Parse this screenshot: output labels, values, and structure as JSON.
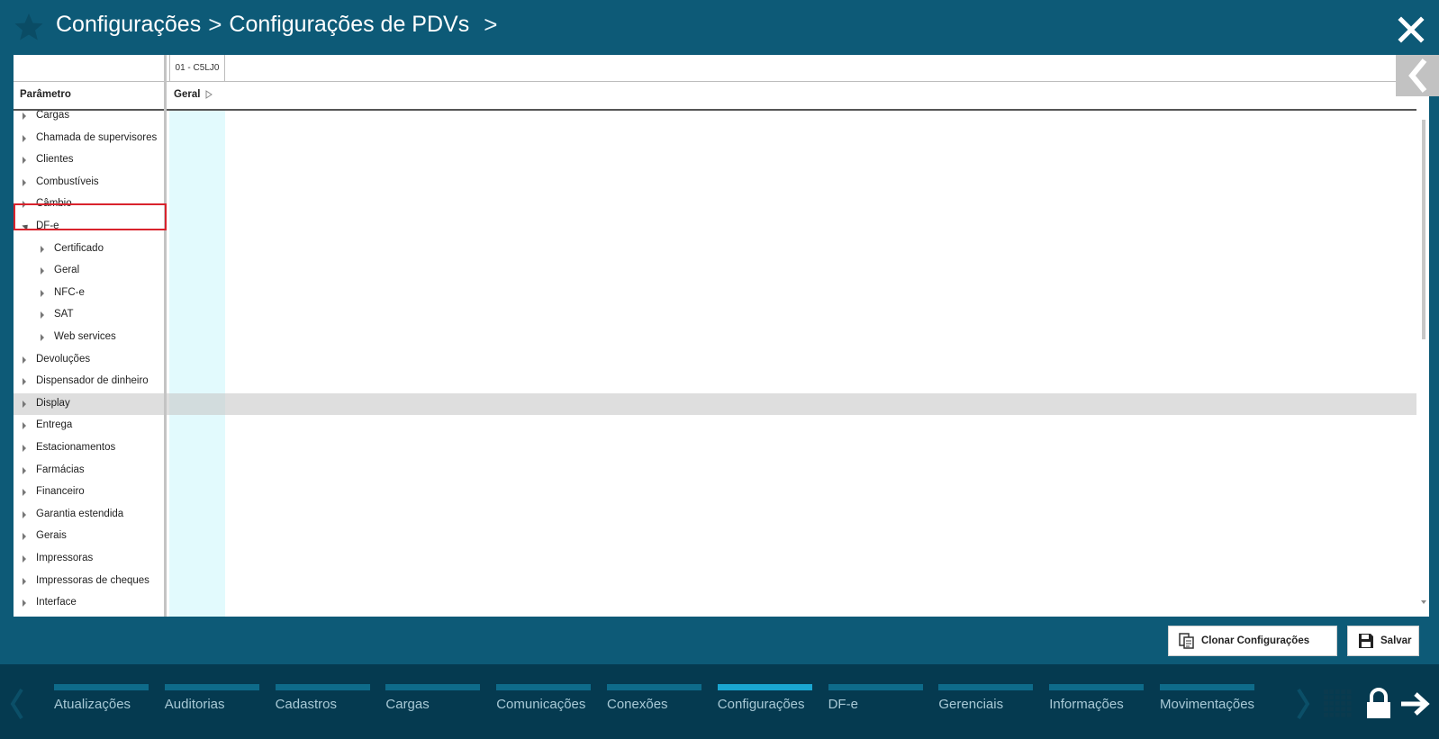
{
  "header": {
    "breadcrumb_1": "Configurações",
    "separator": ">",
    "breadcrumb_2": "Configurações de PDVs",
    "separator_2": ">"
  },
  "grid": {
    "pdv_column": "01 - C5LJ0",
    "param_header": "Parâmetro",
    "group_header": "Geral",
    "rows": [
      {
        "label": "Cargas",
        "level": 0,
        "expanded": false
      },
      {
        "label": "Chamada de supervisores",
        "level": 0,
        "expanded": false
      },
      {
        "label": "Clientes",
        "level": 0,
        "expanded": false
      },
      {
        "label": "Combustíveis",
        "level": 0,
        "expanded": false
      },
      {
        "label": "Câmbio",
        "level": 0,
        "expanded": false
      },
      {
        "label": "DF-e",
        "level": 0,
        "expanded": true
      },
      {
        "label": "Certificado",
        "level": 1,
        "expanded": false
      },
      {
        "label": "Geral",
        "level": 1,
        "expanded": false
      },
      {
        "label": "NFC-e",
        "level": 1,
        "expanded": false
      },
      {
        "label": "SAT",
        "level": 1,
        "expanded": false
      },
      {
        "label": "Web services",
        "level": 1,
        "expanded": false
      },
      {
        "label": "Devoluções",
        "level": 0,
        "expanded": false
      },
      {
        "label": "Dispensador de dinheiro",
        "level": 0,
        "expanded": false
      },
      {
        "label": "Display",
        "level": 0,
        "expanded": false
      },
      {
        "label": "Entrega",
        "level": 0,
        "expanded": false
      },
      {
        "label": "Estacionamentos",
        "level": 0,
        "expanded": false
      },
      {
        "label": "Farmácias",
        "level": 0,
        "expanded": false
      },
      {
        "label": "Financeiro",
        "level": 0,
        "expanded": false
      },
      {
        "label": "Garantia estendida",
        "level": 0,
        "expanded": false
      },
      {
        "label": "Gerais",
        "level": 0,
        "expanded": false
      },
      {
        "label": "Impressoras",
        "level": 0,
        "expanded": false
      },
      {
        "label": "Impressoras de cheques",
        "level": 0,
        "expanded": false
      },
      {
        "label": "Interface",
        "level": 0,
        "expanded": false
      }
    ],
    "selected_row": "DF-e",
    "hovered_row": "Display"
  },
  "actions": {
    "clone_label": "Clonar Configurações",
    "save_label": "Salvar"
  },
  "footer": {
    "tabs": [
      {
        "label": "Atualizações",
        "active": false
      },
      {
        "label": "Auditorias",
        "active": false
      },
      {
        "label": "Cadastros",
        "active": false
      },
      {
        "label": "Cargas",
        "active": false
      },
      {
        "label": "Comunicações",
        "active": false
      },
      {
        "label": "Conexões",
        "active": false
      },
      {
        "label": "Configurações",
        "active": true
      },
      {
        "label": "DF-e",
        "active": false
      },
      {
        "label": "Gerenciais",
        "active": false
      },
      {
        "label": "Informações",
        "active": false
      },
      {
        "label": "Movimentações",
        "active": false
      }
    ]
  },
  "colors": {
    "background": "#0d5a77",
    "footer": "#053a50",
    "tab_bar": "#0e6b8a",
    "tab_bar_active": "#1aa6d1",
    "selection_border": "#d9232d",
    "value_column": "#e2fafd"
  },
  "icons": {
    "star": "star-icon",
    "close": "close-icon",
    "collapse": "chevron-left-icon",
    "clone": "clone-icon",
    "save": "floppy-disk-icon",
    "apps": "grid-icon",
    "lock": "lock-icon",
    "logout": "arrow-right-icon"
  }
}
